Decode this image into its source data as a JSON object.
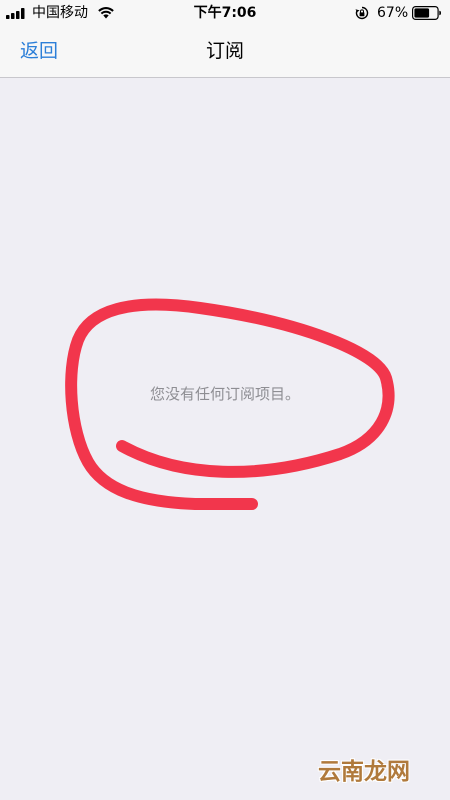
{
  "status_bar": {
    "carrier": "中国移动",
    "time": "下午7:06",
    "battery_percent": "67%",
    "battery_level": 0.67
  },
  "nav": {
    "back_label": "返回",
    "title": "订阅"
  },
  "content": {
    "empty_message": "您没有任何订阅项目。"
  },
  "annotation": {
    "color": "#f2364c"
  },
  "watermark": {
    "text": "云南龙网"
  }
}
